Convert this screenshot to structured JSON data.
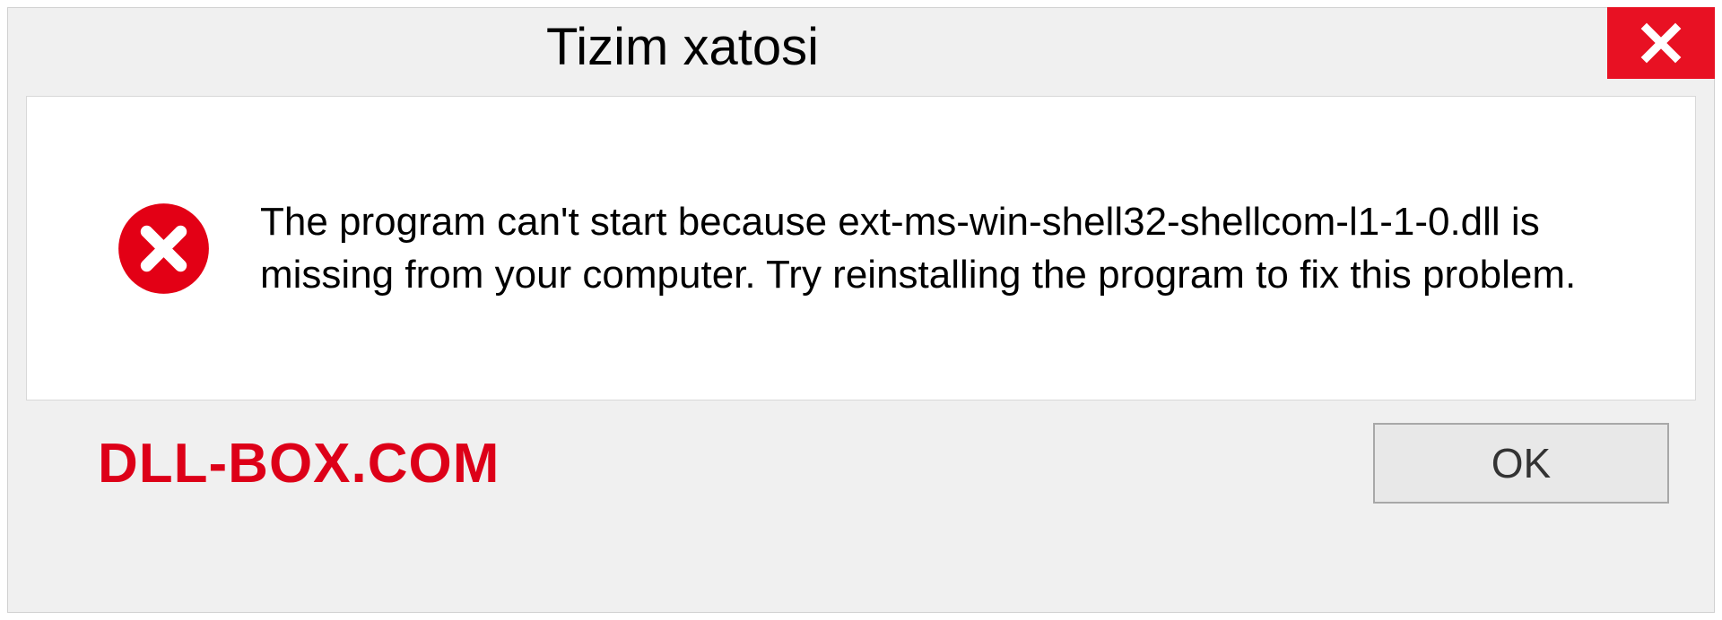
{
  "dialog": {
    "title": "Tizim xatosi",
    "message": "The program can't start because ext-ms-win-shell32-shellcom-l1-1-0.dll is missing from your computer. Try reinstalling the program to fix this problem.",
    "ok_label": "OK"
  },
  "watermark": "DLL-BOX.COM"
}
